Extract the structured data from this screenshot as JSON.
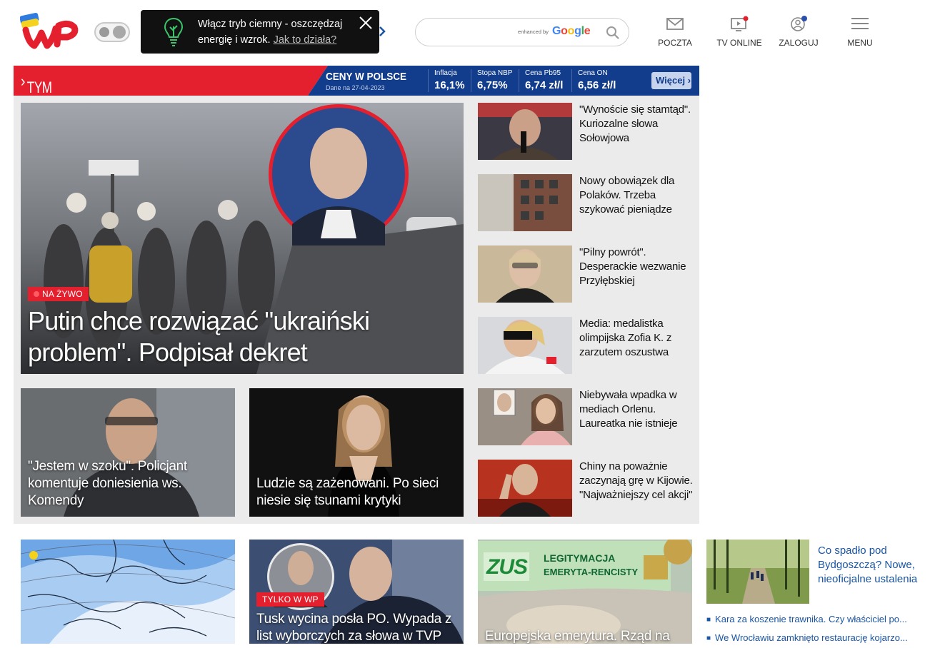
{
  "header": {
    "dark_mode_tip": {
      "text": "Włącz tryb ciemny - oszczędzaj energię i wzrok.",
      "link": "Jak to działa?"
    },
    "search": {
      "enhanced_by": "enhanced by",
      "provider": "Google"
    },
    "nav": [
      {
        "label": "POCZTA",
        "icon": "mail-icon"
      },
      {
        "label": "TV ONLINE",
        "icon": "tv-icon"
      },
      {
        "label": "ZALOGUJ",
        "icon": "user-icon"
      },
      {
        "label": "MENU",
        "icon": "hamburger-icon"
      }
    ]
  },
  "band": {
    "left_title": "TYM ŻYJE POLSKA",
    "prices_title": "CENY W POLSCE",
    "prices_date": "Dane na 27-04-2023",
    "indicators": [
      {
        "label": "Inflacja",
        "value": "16,1%"
      },
      {
        "label": "Stopa NBP",
        "value": "6,75%"
      },
      {
        "label": "Cena Pb95",
        "value": "6,74 zł/l"
      },
      {
        "label": "Cena ON",
        "value": "6,56 zł/l"
      }
    ],
    "more_label": "Więcej"
  },
  "hero": {
    "badge": "NA ŻYWO",
    "title": "Putin chce rozwiązać \"ukraiński problem\". Podpisał dekret"
  },
  "tiles": [
    {
      "title": "\"Jestem w szoku\". Policjant komentuje doniesienia ws. Komendy"
    },
    {
      "title": "Ludzie są zażenowani. Po sieci niesie się tsunami krytyki"
    }
  ],
  "side_news": [
    {
      "title": "\"Wynoście się stamtąd\". Kuriozalne słowa Sołowjowa"
    },
    {
      "title": "Nowy obowiązek dla Polaków. Trzeba szykować pieniądze"
    },
    {
      "title": "\"Pilny powrót\". Desperackie wezwanie Przyłębskiej"
    },
    {
      "title": "Media: medalistka olimpijska Zofia K. z zarzutem oszustwa"
    },
    {
      "title": "Niebywała wpadka w mediach Orlenu. Laureatka nie istnieje"
    },
    {
      "title": "Chiny na poważnie zaczynają grę w Kijowie. \"Najważniejszy cel akcji\""
    }
  ],
  "bottom": [
    {
      "title": ""
    },
    {
      "badge": "TYLKO W WP",
      "title": "Tusk wycina posła PO. Wypada z list wyborczych za słowa w TVP"
    },
    {
      "title": "Europejska emerytura. Rząd na",
      "card_text_1": "LEGITYMACJA",
      "card_text_2": "EMERYTA-RENCISTY",
      "card_logo": "ZUS"
    }
  ],
  "right_column": {
    "title": "Co spadło pod Bydgoszczą? Nowe, nieoficjalne ustalenia",
    "links": [
      "Kara za koszenie trawnika. Czy właściciel po...",
      "We Wrocławiu zamknięto restaurację kojarzo..."
    ]
  },
  "colors": {
    "brand_red": "#e5202e",
    "navy": "#123c8c",
    "link_blue": "#1a55a3"
  }
}
